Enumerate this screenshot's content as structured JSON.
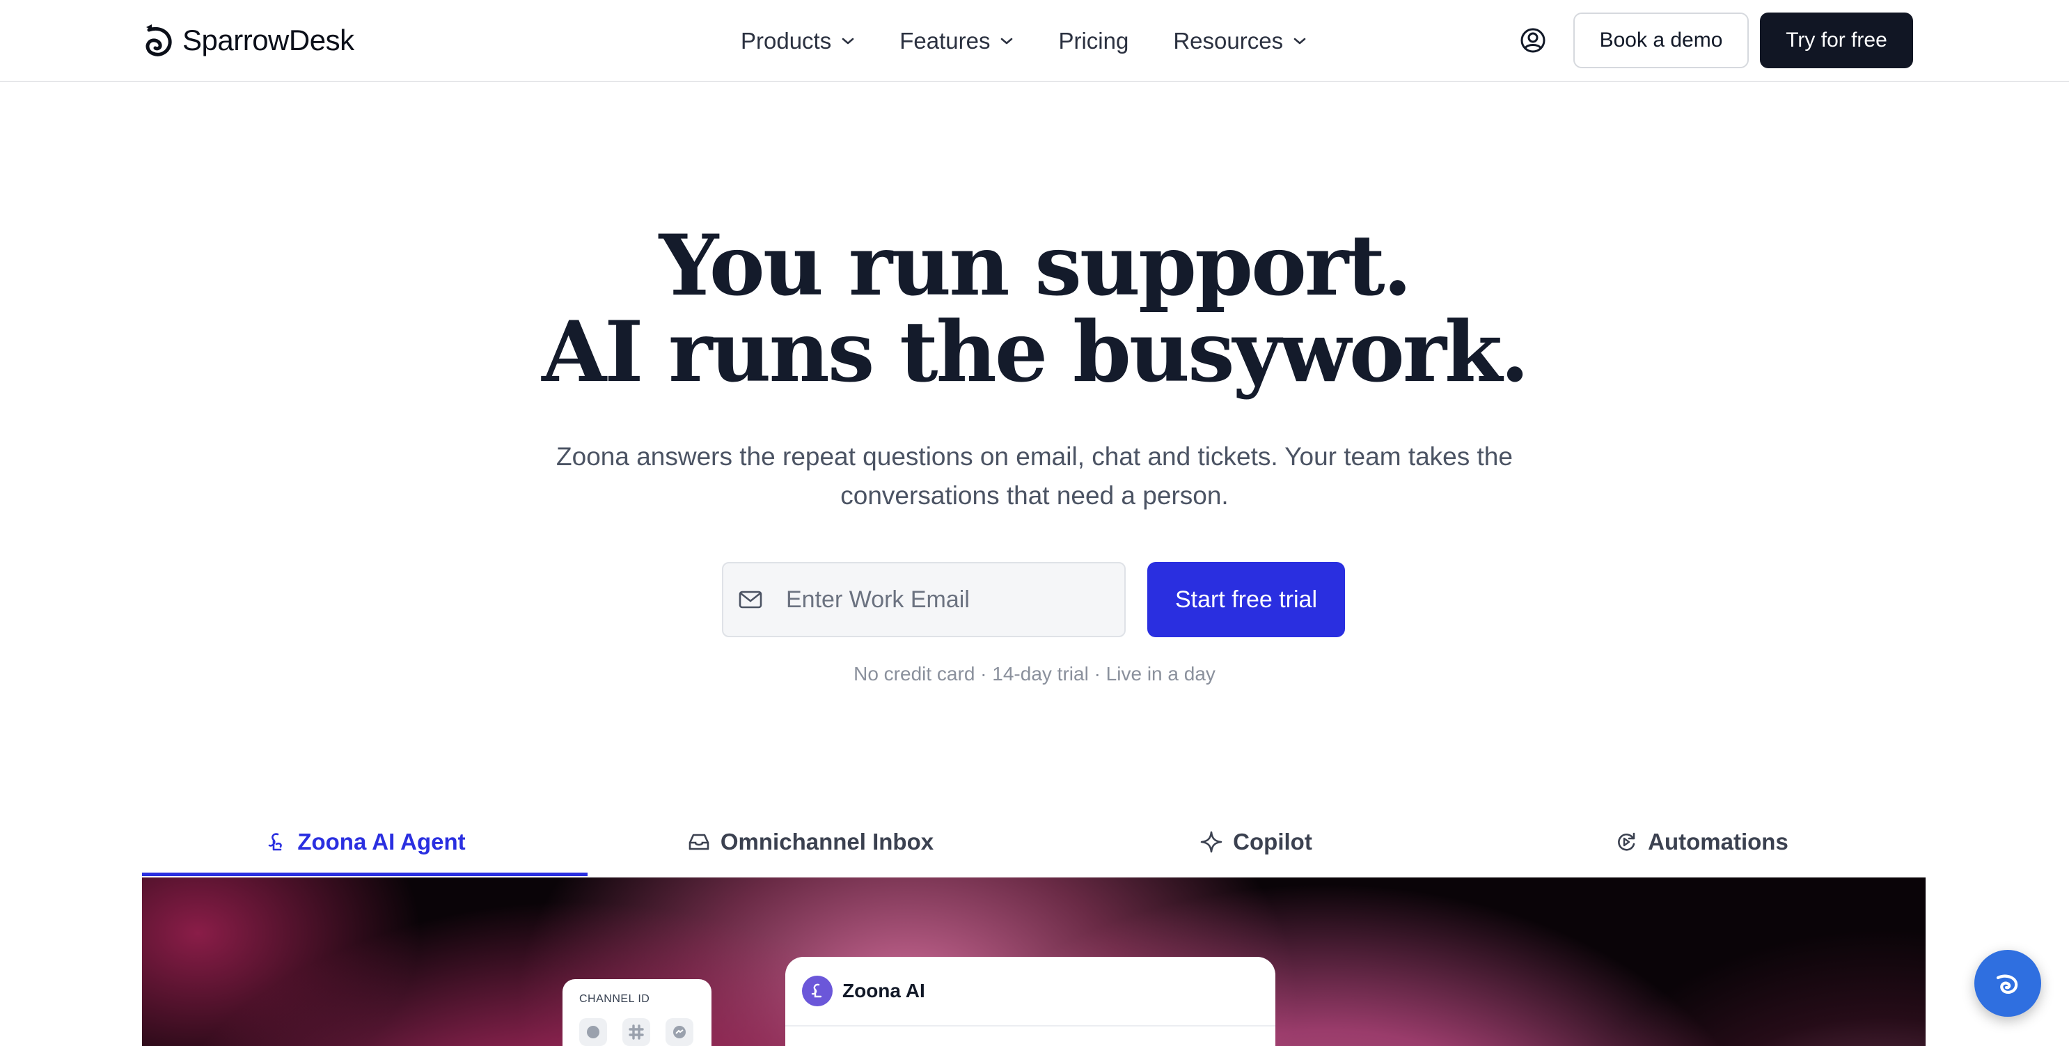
{
  "brand": {
    "name": "SparrowDesk"
  },
  "nav": {
    "items": [
      {
        "label": "Products",
        "has_dropdown": true
      },
      {
        "label": "Features",
        "has_dropdown": true
      },
      {
        "label": "Pricing",
        "has_dropdown": false
      },
      {
        "label": "Resources",
        "has_dropdown": true
      }
    ],
    "book_demo": "Book a demo",
    "try_free": "Try for free"
  },
  "hero": {
    "title_line1": "You run support.",
    "title_line2": "AI runs the busywork.",
    "subtitle": "Zoona answers the repeat questions on email, chat and tickets. Your team takes the conversations that need a person.",
    "email_placeholder": "Enter Work Email",
    "cta": "Start free trial",
    "note": "No credit card · 14-day trial · Live in a day"
  },
  "tabs": [
    {
      "label": "Zoona AI Agent",
      "icon": "zoona-icon",
      "active": true
    },
    {
      "label": "Omnichannel Inbox",
      "icon": "inbox-icon",
      "active": false
    },
    {
      "label": "Copilot",
      "icon": "sparkle-icon",
      "active": false
    },
    {
      "label": "Automations",
      "icon": "automation-icon",
      "active": false
    }
  ],
  "showcase": {
    "channel_card_title": "CHANNEL ID",
    "chat_title": "Zoona AI"
  },
  "colors": {
    "accent": "#2a2fe0",
    "dark": "#111624",
    "heading": "#141b2b"
  }
}
